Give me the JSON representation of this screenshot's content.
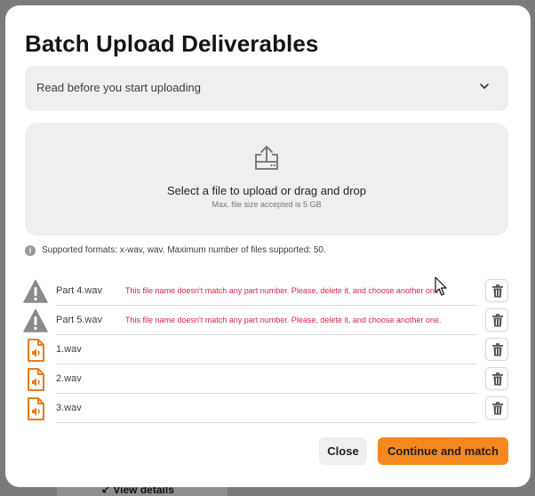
{
  "background": {
    "link_text": "View details"
  },
  "dialog": {
    "title": "Batch Upload Deliverables",
    "accordion": {
      "label": "Read before you start uploading",
      "icon": "chevron-down-icon"
    },
    "dropzone": {
      "icon": "upload-tray-icon",
      "main_text": "Select a file to upload or drag and drop",
      "sub_text": "Max. file size accepted is 5 GB"
    },
    "formats_note": {
      "icon": "info-icon",
      "text": "Supported formats: x-wav, wav. Maximum number of files supported: 50."
    },
    "files": [
      {
        "name": "Part 4.wav",
        "icon": "warning-icon",
        "error": "This file name doesn't match any part number. Please, delete it, and choose another one."
      },
      {
        "name": "Part 5.wav",
        "icon": "warning-icon",
        "error": "This file name doesn't match any part number. Please, delete it, and choose another one."
      },
      {
        "name": "1.wav",
        "icon": "audio-file-icon",
        "error": ""
      },
      {
        "name": "2.wav",
        "icon": "audio-file-icon",
        "error": ""
      },
      {
        "name": "3.wav",
        "icon": "audio-file-icon",
        "error": ""
      }
    ],
    "buttons": {
      "close": "Close",
      "continue": "Continue and match"
    }
  },
  "colors": {
    "accent": "#f5881f",
    "error": "#d3264b",
    "warning_icon": "#8a8a8a",
    "audio_icon": "#e97c1c"
  }
}
